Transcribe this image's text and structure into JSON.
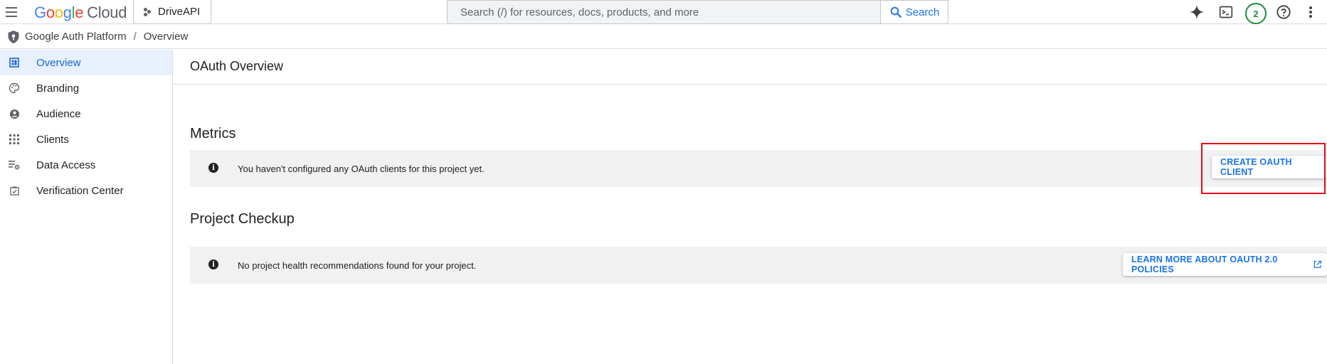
{
  "topbar": {
    "logo": {
      "g": "G",
      "o1": "o",
      "o2": "o",
      "g2": "g",
      "l": "l",
      "e": "e",
      "cloud": "Cloud"
    },
    "project": "DriveAPI",
    "search_placeholder": "Search (/) for resources, docs, products, and more",
    "search_button": "Search",
    "badge": "2"
  },
  "breadcrumb": {
    "items": [
      "Google Auth Platform",
      "Overview"
    ],
    "separator": "/"
  },
  "sidebar": {
    "items": [
      {
        "label": "Overview",
        "icon": "dashboard-icon",
        "active": true
      },
      {
        "label": "Branding",
        "icon": "palette-icon"
      },
      {
        "label": "Audience",
        "icon": "account-circle-icon"
      },
      {
        "label": "Clients",
        "icon": "apps-grid-icon"
      },
      {
        "label": "Data Access",
        "icon": "data-access-icon"
      },
      {
        "label": "Verification Center",
        "icon": "verification-icon"
      }
    ]
  },
  "main": {
    "title": "OAuth Overview",
    "metrics": {
      "title": "Metrics",
      "message": "You haven't configured any OAuth clients for this project yet.",
      "button": "CREATE OAUTH CLIENT"
    },
    "checkup": {
      "title": "Project Checkup",
      "message": "No project health recommendations found for your project.",
      "button": "LEARN MORE ABOUT OAUTH 2.0 POLICIES"
    }
  },
  "colors": {
    "accent": "#1a73e8",
    "active_bg": "#e8f0fe",
    "highlight": "#e50914",
    "badge": "#1e8e3e"
  }
}
